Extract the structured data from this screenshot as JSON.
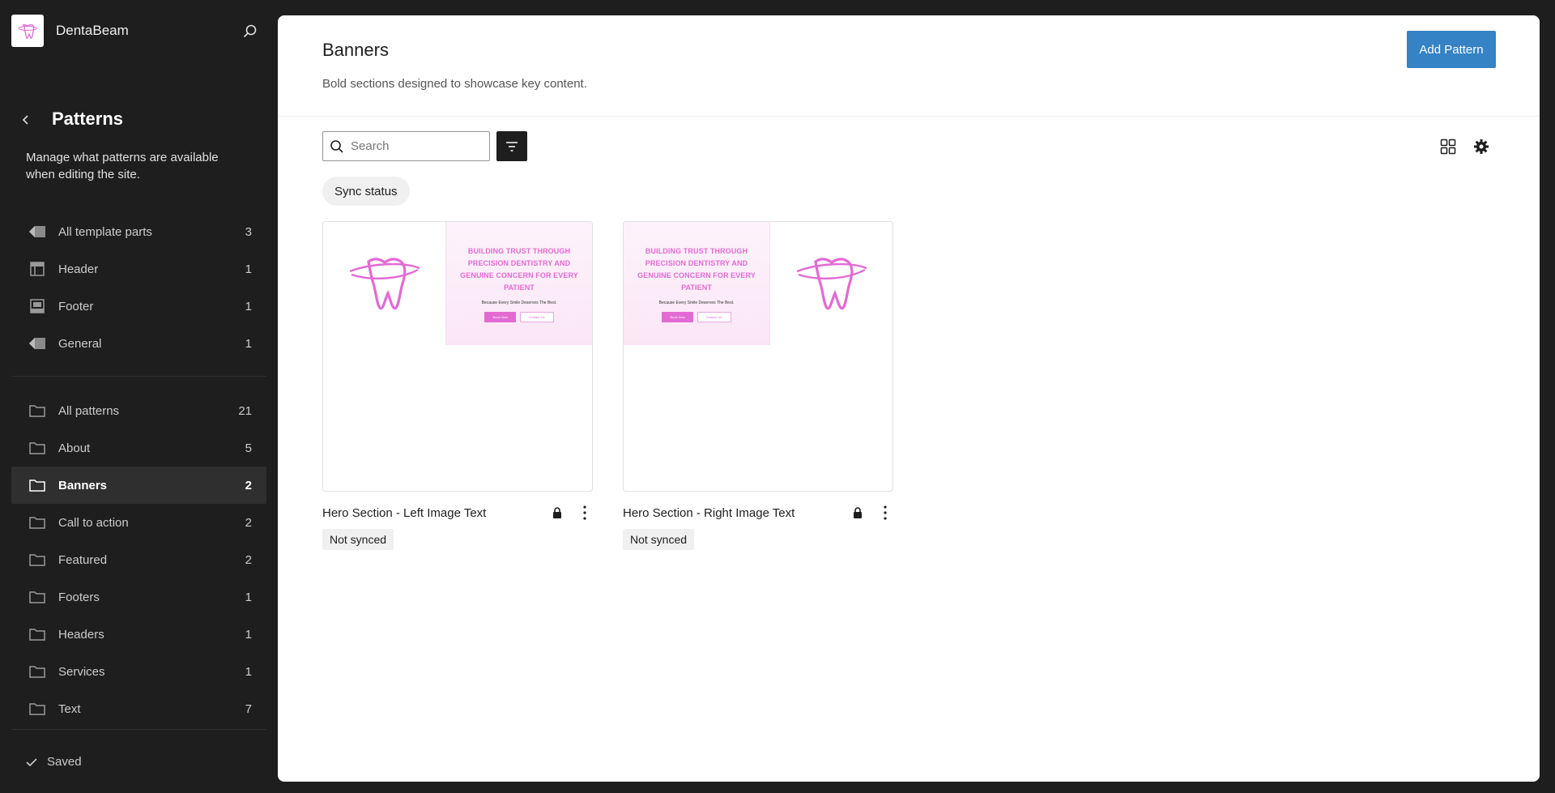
{
  "site": {
    "name": "DentaBeam",
    "logo_icon": "tooth-logo-icon"
  },
  "sidebar": {
    "title": "Patterns",
    "description": "Manage what patterns are available when editing the site.",
    "template_parts": [
      {
        "label": "All template parts",
        "count": "3",
        "icon": "symbol-icon"
      },
      {
        "label": "Header",
        "count": "1",
        "icon": "header-icon"
      },
      {
        "label": "Footer",
        "count": "1",
        "icon": "footer-icon"
      },
      {
        "label": "General",
        "count": "1",
        "icon": "symbol-icon"
      }
    ],
    "categories": [
      {
        "label": "All patterns",
        "count": "21",
        "icon": "folder-icon"
      },
      {
        "label": "About",
        "count": "5",
        "icon": "folder-icon"
      },
      {
        "label": "Banners",
        "count": "2",
        "icon": "folder-icon",
        "active": true
      },
      {
        "label": "Call to action",
        "count": "2",
        "icon": "folder-icon"
      },
      {
        "label": "Featured",
        "count": "2",
        "icon": "folder-icon"
      },
      {
        "label": "Footers",
        "count": "1",
        "icon": "folder-icon"
      },
      {
        "label": "Headers",
        "count": "1",
        "icon": "folder-icon"
      },
      {
        "label": "Services",
        "count": "1",
        "icon": "folder-icon"
      },
      {
        "label": "Text",
        "count": "7",
        "icon": "folder-icon"
      }
    ],
    "saved_label": "Saved"
  },
  "main": {
    "title": "Banners",
    "description": "Bold sections designed to showcase key content.",
    "add_button": "Add Pattern",
    "search_placeholder": "Search",
    "filter_chip": "Sync status",
    "cards": [
      {
        "title": "Hero Section - Left Image Text",
        "badge": "Not synced",
        "preview": {
          "heading": "BUILDING TRUST THROUGH PRECISION DENTISTRY AND GENUINE CONCERN FOR EVERY PATIENT",
          "sub": "Because Every Smile Deserves The Best.",
          "btn1": "Book Now",
          "btn2": "Contact Us"
        }
      },
      {
        "title": "Hero Section - Right Image Text",
        "badge": "Not synced",
        "preview": {
          "heading": "BUILDING TRUST THROUGH PRECISION DENTISTRY AND GENUINE CONCERN FOR EVERY PATIENT",
          "sub": "Because Every Smile Deserves The Best.",
          "btn1": "Book Now",
          "btn2": "Contact Us"
        }
      }
    ]
  },
  "colors": {
    "accent": "#3582c4",
    "brand_pink": "#e36ad3",
    "sidebar_bg": "#1e1e1e"
  }
}
